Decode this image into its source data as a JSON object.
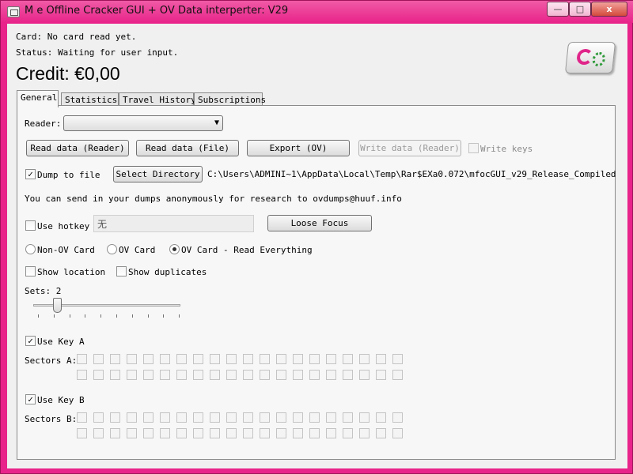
{
  "window": {
    "title": "M       e Offline Cracker GUI + OV Data interperter: V29",
    "min_glyph": "—",
    "max_glyph": "□",
    "close_glyph": "x"
  },
  "header": {
    "card_text": "Card: No card read yet.",
    "status_text": "Status: Waiting for user input.",
    "credit_text": "Credit: €0,00"
  },
  "tabs": [
    {
      "label": "General",
      "active": true
    },
    {
      "label": "Statistics"
    },
    {
      "label": "Travel History"
    },
    {
      "label": "Subscriptions"
    }
  ],
  "general": {
    "reader_label": "Reader:",
    "reader_value": "",
    "dropdown_arrow": "▼",
    "buttons": {
      "read_reader": "Read data (Reader)",
      "read_file": "Read data (File)",
      "export_ov": "Export (OV)",
      "write_reader": "Write data (Reader)",
      "select_directory": "Select Directory",
      "loose_focus": "Loose Focus"
    },
    "write_keys_label": "Write keys",
    "write_keys_checked": false,
    "dump_to_file_label": "Dump to file",
    "dump_to_file_checked": true,
    "dump_path": "C:\\Users\\ADMINI~1\\AppData\\Local\\Temp\\Rar$EXa0.072\\mfocGUI_v29_Release_Compiled",
    "send_dumps_text": "You can send in your dumps anonymously for research to ovdumps@huuf.info",
    "use_hotkey_label": "Use hotkey",
    "use_hotkey_checked": false,
    "hotkey_value": "无",
    "card_type_options": [
      "Non-OV Card",
      "OV Card",
      "OV Card - Read Everything"
    ],
    "card_type_selected": "OV Card - Read Everything",
    "show_location_label": "Show location",
    "show_location_checked": false,
    "show_duplicates_label": "Show duplicates",
    "show_duplicates_checked": false,
    "sets_text": "Sets: 2",
    "sets_value": 2,
    "use_key_a_label": "Use Key A",
    "use_key_a_checked": true,
    "use_key_b_label": "Use Key B",
    "use_key_b_checked": true,
    "sectors_a_label": "Sectors A:",
    "sectors_b_label": "Sectors B:",
    "check_glyph": "✓"
  }
}
